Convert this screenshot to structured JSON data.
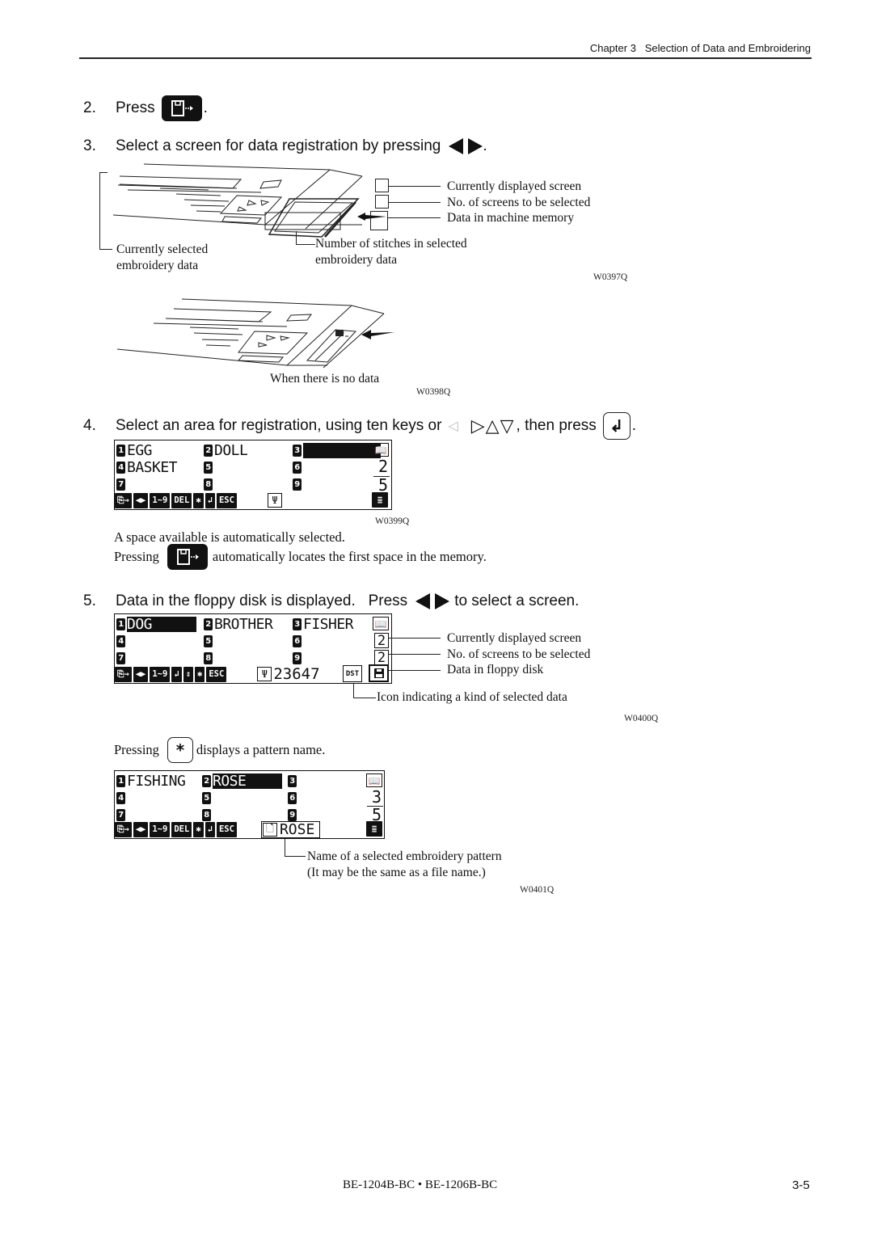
{
  "header": {
    "chapter": "Chapter 3   Selection of Data and Embroidering"
  },
  "steps": [
    {
      "number": "2.",
      "text_before": "Press",
      "icon": "floppy-exit-key-icon",
      "text_after": "."
    },
    {
      "number": "3.",
      "text_before": "Select a screen for data registration by pressing",
      "icons": [
        "left-triangle-key-icon",
        "right-triangle-key-icon"
      ],
      "text_after": "."
    },
    {
      "number": "4.",
      "text_before": "Select an area for registration, using ten keys or",
      "icons": [
        "left-outline-triangle-icon"
      ],
      "arrows": "▷△▽",
      "text_middle": ", then press",
      "key": "↲",
      "text_after": "."
    },
    {
      "number": "5.",
      "text_before": "Data in the floppy disk is displayed.   Press",
      "icons": [
        "left-triangle-key-icon",
        "right-triangle-key-icon"
      ],
      "text_after": "to select a screen."
    }
  ],
  "figure1": {
    "callouts": {
      "currently_displayed_screen": "Currently displayed screen",
      "no_of_screens": "No. of screens to be selected",
      "data_in_memory": "Data in machine memory",
      "currently_selected": [
        "Currently selected",
        "embroidery data"
      ],
      "number_of_stitches": [
        "Number of stitches in selected",
        "embroidery data"
      ]
    },
    "code": "W0397Q"
  },
  "figure2": {
    "caption": "When there is no data",
    "code": "W0398Q"
  },
  "figure3": {
    "lcd": {
      "cells": [
        {
          "badge": "1",
          "label": "EGG",
          "selected": false
        },
        {
          "badge": "2",
          "label": "DOLL",
          "selected": false
        },
        {
          "badge": "3",
          "label": "",
          "selected": true
        },
        {
          "badge": "4",
          "label": "BASKET",
          "selected": false
        },
        {
          "badge": "5",
          "label": "",
          "selected": false
        },
        {
          "badge": "6",
          "label": "",
          "selected": false
        },
        {
          "badge": "7",
          "label": "",
          "selected": false
        },
        {
          "badge": "8",
          "label": "",
          "selected": false
        },
        {
          "badge": "9",
          "label": "",
          "selected": false
        }
      ],
      "current_screen": "2",
      "total_screens": "5",
      "toolbar": [
        "⎘→",
        "◀▶",
        "1~9",
        "DEL",
        "✱",
        "↲",
        "ESC"
      ],
      "stitch_icon": "needle-icon",
      "stitch_count": ""
    },
    "code": "W0399Q"
  },
  "step4_notes": {
    "line1": "A space available is automatically selected.",
    "line2_before": "Pressing",
    "line2_after": "automatically locates the first space in the memory."
  },
  "figure4": {
    "lcd": {
      "cells": [
        {
          "badge": "1",
          "label": "DOG",
          "selected": true
        },
        {
          "badge": "2",
          "label": "BROTHER",
          "selected": false
        },
        {
          "badge": "3",
          "label": "FISHER",
          "selected": false
        },
        {
          "badge": "4",
          "label": "",
          "selected": false
        },
        {
          "badge": "5",
          "label": "",
          "selected": false
        },
        {
          "badge": "6",
          "label": "",
          "selected": false
        },
        {
          "badge": "7",
          "label": "",
          "selected": false
        },
        {
          "badge": "8",
          "label": "",
          "selected": false
        },
        {
          "badge": "9",
          "label": "",
          "selected": false
        }
      ],
      "current_screen": "2",
      "total_screens": "2",
      "toolbar": [
        "⎘→",
        "◀▶",
        "1~9",
        "↲",
        "⇕",
        "✱",
        "ESC"
      ],
      "stitch_count": "23647",
      "data_type": "DST",
      "source_icon": "floppy-disk-icon"
    },
    "callouts": {
      "currently_displayed_screen": "Currently displayed screen",
      "no_of_screens": "No. of screens to be selected",
      "data_in_floppy": "Data in floppy disk",
      "data_kind_icon": "Icon indicating a kind of selected data"
    },
    "code": "W0400Q"
  },
  "pattern_note": {
    "before": "Pressing",
    "key": "*",
    "after": "displays a pattern name."
  },
  "figure5": {
    "lcd": {
      "cells": [
        {
          "badge": "1",
          "label": "FISHING",
          "selected": false
        },
        {
          "badge": "2",
          "label": "ROSE",
          "selected": true
        },
        {
          "badge": "3",
          "label": "",
          "selected": false
        },
        {
          "badge": "4",
          "label": "",
          "selected": false
        },
        {
          "badge": "5",
          "label": "",
          "selected": false
        },
        {
          "badge": "6",
          "label": "",
          "selected": false
        },
        {
          "badge": "7",
          "label": "",
          "selected": false
        },
        {
          "badge": "8",
          "label": "",
          "selected": false
        },
        {
          "badge": "9",
          "label": "",
          "selected": false
        }
      ],
      "current_screen": "3",
      "total_screens": "5",
      "toolbar": [
        "⎘→",
        "◀▶",
        "1~9",
        "DEL",
        "✱",
        "↲",
        "ESC"
      ],
      "pattern_name": "ROSE"
    },
    "callout": [
      "Name of a selected embroidery pattern",
      "(It may be the same as a file name.)"
    ],
    "code": "W0401Q"
  },
  "footer": {
    "models": "BE-1204B-BC • BE-1206B-BC",
    "page": "3-5"
  }
}
